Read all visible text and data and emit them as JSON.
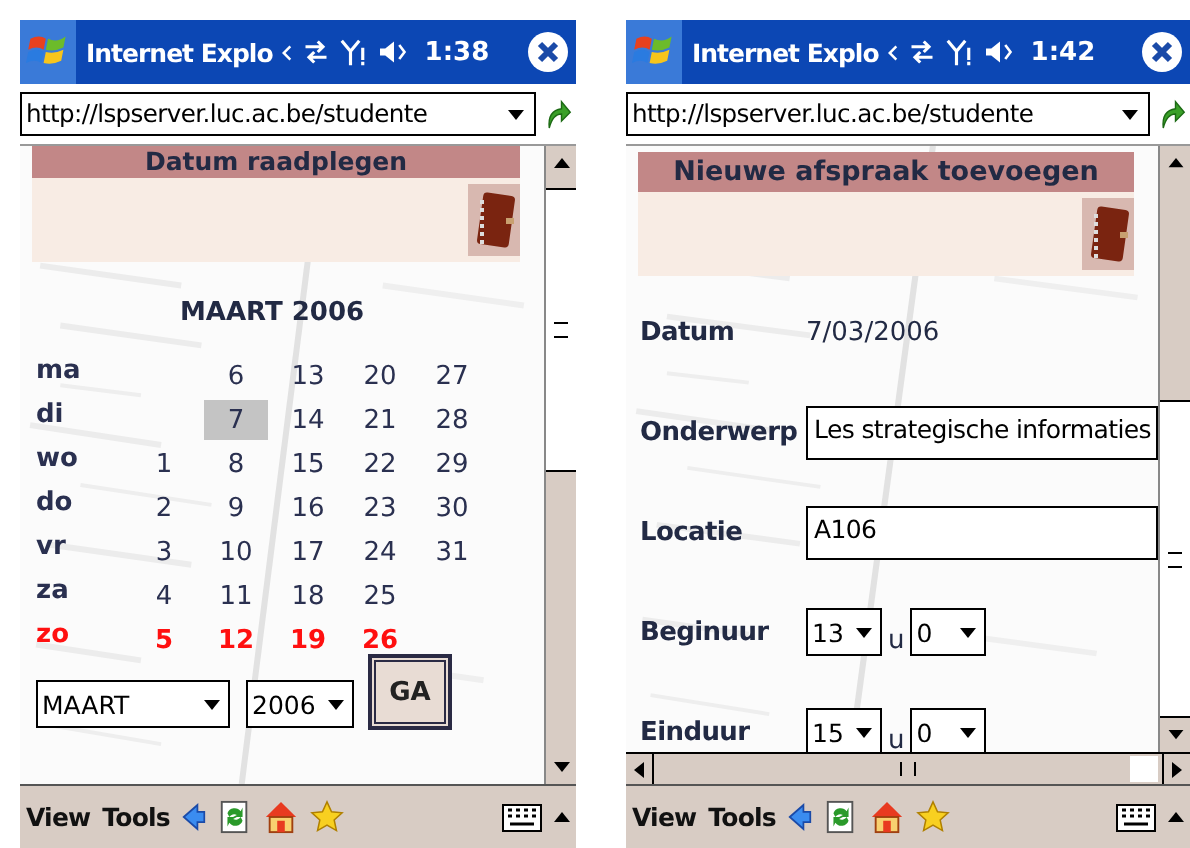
{
  "screens": [
    {
      "kind": "calendar",
      "title": "Internet Explo",
      "time": "1:38",
      "url": "http://lspserver.luc.ac.be/studente",
      "header": "Datum raadplegen",
      "month_title": "MAART 2006",
      "weekdays": [
        {
          "label": "ma",
          "sunday": false
        },
        {
          "label": "di",
          "sunday": false
        },
        {
          "label": "wo",
          "sunday": false
        },
        {
          "label": "do",
          "sunday": false
        },
        {
          "label": "vr",
          "sunday": false
        },
        {
          "label": "za",
          "sunday": false
        },
        {
          "label": "zo",
          "sunday": true
        }
      ],
      "weeks": [
        {
          "days": [
            {
              "label": "1",
              "selected": false
            },
            {
              "label": "2",
              "selected": false
            },
            {
              "label": "3",
              "selected": false
            },
            {
              "label": "4",
              "selected": false
            },
            {
              "label": "5",
              "selected": false
            }
          ]
        },
        {
          "days": [
            {
              "label": "6",
              "selected": false
            },
            {
              "label": "7",
              "selected": true
            },
            {
              "label": "8",
              "selected": false
            },
            {
              "label": "9",
              "selected": false
            },
            {
              "label": "10",
              "selected": false
            },
            {
              "label": "11",
              "selected": false
            },
            {
              "label": "12",
              "selected": false
            }
          ]
        },
        {
          "days": [
            {
              "label": "13",
              "selected": false
            },
            {
              "label": "14",
              "selected": false
            },
            {
              "label": "15",
              "selected": false
            },
            {
              "label": "16",
              "selected": false
            },
            {
              "label": "17",
              "selected": false
            },
            {
              "label": "18",
              "selected": false
            },
            {
              "label": "19",
              "selected": false
            }
          ]
        },
        {
          "days": [
            {
              "label": "20",
              "selected": false
            },
            {
              "label": "21",
              "selected": false
            },
            {
              "label": "22",
              "selected": false
            },
            {
              "label": "23",
              "selected": false
            },
            {
              "label": "24",
              "selected": false
            },
            {
              "label": "25",
              "selected": false
            },
            {
              "label": "26",
              "selected": false
            }
          ]
        },
        {
          "days": [
            {
              "label": "27",
              "selected": false
            },
            {
              "label": "28",
              "selected": false
            },
            {
              "label": "29",
              "selected": false
            },
            {
              "label": "30",
              "selected": false
            },
            {
              "label": "31",
              "selected": false
            }
          ]
        }
      ],
      "month_select": "MAART",
      "year_select": "2006",
      "go_button": "GA",
      "menu": [
        "View",
        "Tools"
      ]
    },
    {
      "kind": "form",
      "title": "Internet Explo",
      "time": "1:42",
      "url": "http://lspserver.luc.ac.be/studente",
      "header": "Nieuwe afspraak toevoegen",
      "fields": [
        {
          "kind": "text",
          "label": "Datum",
          "value": "7/03/2006"
        },
        {
          "kind": "input",
          "label": "Onderwerp",
          "value": "Les strategische informaties"
        },
        {
          "kind": "input",
          "label": "Locatie",
          "value": "A106"
        },
        {
          "kind": "time",
          "label": "Beginuur",
          "hour": "13",
          "sep": "u",
          "minute": "0"
        },
        {
          "kind": "time",
          "label": "Einduur",
          "hour": "15",
          "sep": "u",
          "minute": "0"
        }
      ],
      "menu": [
        "View",
        "Tools"
      ]
    }
  ]
}
